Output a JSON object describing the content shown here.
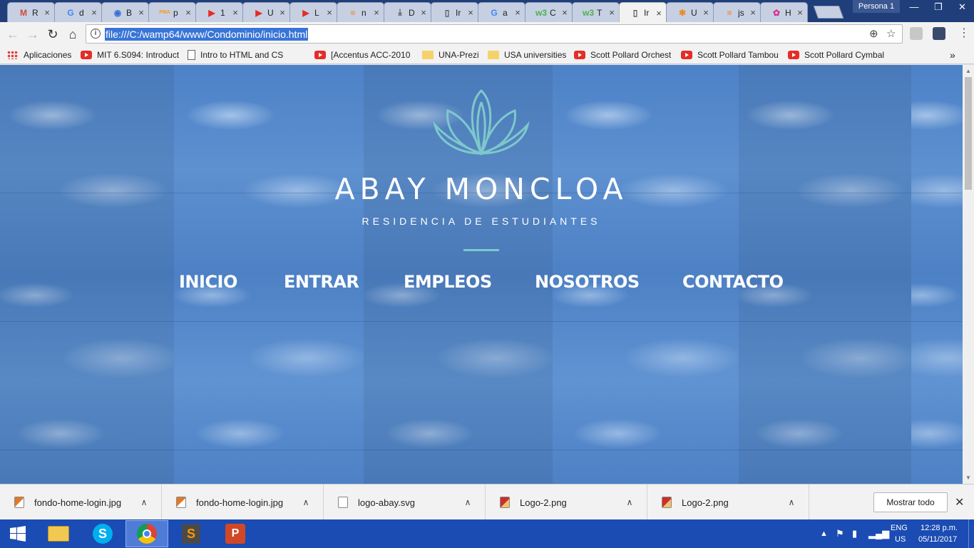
{
  "tabs": [
    {
      "letter": "R",
      "icon": "gmail-icon",
      "icon_glyph": "M",
      "icon_color": "#d14836"
    },
    {
      "letter": "d",
      "icon": "google-icon",
      "icon_glyph": "G",
      "icon_color": "#4285f4"
    },
    {
      "letter": "B",
      "icon": "globe-icon",
      "icon_glyph": "◉",
      "icon_color": "#3b6fd1"
    },
    {
      "letter": "p",
      "icon": "phpmyadmin-icon",
      "icon_glyph": "PMA",
      "icon_color": "#f89c0e"
    },
    {
      "letter": "1",
      "icon": "youtube-icon",
      "icon_glyph": "▶",
      "icon_color": "#e52d27"
    },
    {
      "letter": "U",
      "icon": "youtube-icon",
      "icon_glyph": "▶",
      "icon_color": "#e52d27"
    },
    {
      "letter": "L",
      "icon": "youtube-icon",
      "icon_glyph": "▶",
      "icon_color": "#e52d27"
    },
    {
      "letter": "n",
      "icon": "stackoverflow-icon",
      "icon_glyph": "≡",
      "icon_color": "#f48024"
    },
    {
      "letter": "D",
      "icon": "download-icon",
      "icon_glyph": "⤓",
      "icon_color": "#555555"
    },
    {
      "letter": "Ir",
      "icon": "page-icon",
      "icon_glyph": "▯",
      "icon_color": "#555555"
    },
    {
      "letter": "a",
      "icon": "google-icon",
      "icon_glyph": "G",
      "icon_color": "#4285f4"
    },
    {
      "letter": "C",
      "icon": "w3schools-icon",
      "icon_glyph": "w3",
      "icon_color": "#4caf50"
    },
    {
      "letter": "T",
      "icon": "w3schools-icon",
      "icon_glyph": "w3",
      "icon_color": "#4caf50"
    },
    {
      "letter": "Ir",
      "icon": "page-icon",
      "icon_glyph": "▯",
      "icon_color": "#555555"
    },
    {
      "letter": "U",
      "icon": "asterisk-icon",
      "icon_glyph": "✱",
      "icon_color": "#f08a24"
    },
    {
      "letter": "js",
      "icon": "stackoverflow-icon",
      "icon_glyph": "≡",
      "icon_color": "#f48024"
    },
    {
      "letter": "H",
      "icon": "color-wheel-icon",
      "icon_glyph": "✿",
      "icon_color": "#d62f8f"
    }
  ],
  "active_tab_index": 13,
  "tab_close_glyph": "×",
  "profile_label": "Persona 1",
  "window_controls": [
    "—",
    "❐",
    "✕"
  ],
  "toolbar": {
    "back_glyph": "←",
    "forward_glyph": "→",
    "reload_glyph": "↻",
    "home_glyph": "⌂",
    "info_glyph": "i",
    "url": "file:///C:/wamp64/www/Condominio/inicio.html",
    "zoom_glyph": "⊕",
    "star_glyph": "☆",
    "menu_glyph": "⋮"
  },
  "bookmarks": [
    {
      "label": "Aplicaciones",
      "icon": "apps-grid-icon"
    },
    {
      "label": "MIT 6.S094: Introduct",
      "icon": "youtube-icon"
    },
    {
      "label": "Intro to HTML and CS",
      "icon": "page-icon"
    },
    {
      "label": "[Accentus ACC-2010",
      "icon": "youtube-icon"
    },
    {
      "label": "UNA-Prezi",
      "icon": "folder-icon"
    },
    {
      "label": "USA universities",
      "icon": "folder-icon"
    },
    {
      "label": "Scott Pollard Orchest",
      "icon": "youtube-icon"
    },
    {
      "label": "Scott Pollard Tambou",
      "icon": "youtube-icon"
    },
    {
      "label": "Scott Pollard Cymbal",
      "icon": "youtube-icon"
    }
  ],
  "bookmarks_overflow": "»",
  "page": {
    "brand": "ABAY MONCLOA",
    "tagline": "RESIDENCIA DE ESTUDIANTES",
    "nav": [
      "INICIO",
      "ENTRAR",
      "EMPLEOS",
      "NOSOTROS",
      "CONTACTO"
    ],
    "logo_color": "#7ec8cc",
    "accent_color": "#7ec8cc",
    "background_color": "#4f7fbd"
  },
  "downloads": [
    {
      "filename": "fondo-home-login.jpg",
      "type": "img"
    },
    {
      "filename": "fondo-home-login.jpg",
      "type": "img"
    },
    {
      "filename": "logo-abay.svg",
      "type": "svg"
    },
    {
      "filename": "Logo-2.png",
      "type": "red"
    },
    {
      "filename": "Logo-2.png",
      "type": "red"
    }
  ],
  "download_chevron": "∧",
  "show_all_label": "Mostrar todo",
  "download_close_glyph": "✕",
  "taskbar": {
    "apps": [
      "file-explorer-icon",
      "skype-icon",
      "chrome-icon",
      "sublime-text-icon",
      "powerpoint-icon"
    ],
    "active_app": "chrome-icon",
    "lang": "ENG",
    "region": "US",
    "time": "12:28 p.m.",
    "date": "05/11/2017"
  }
}
